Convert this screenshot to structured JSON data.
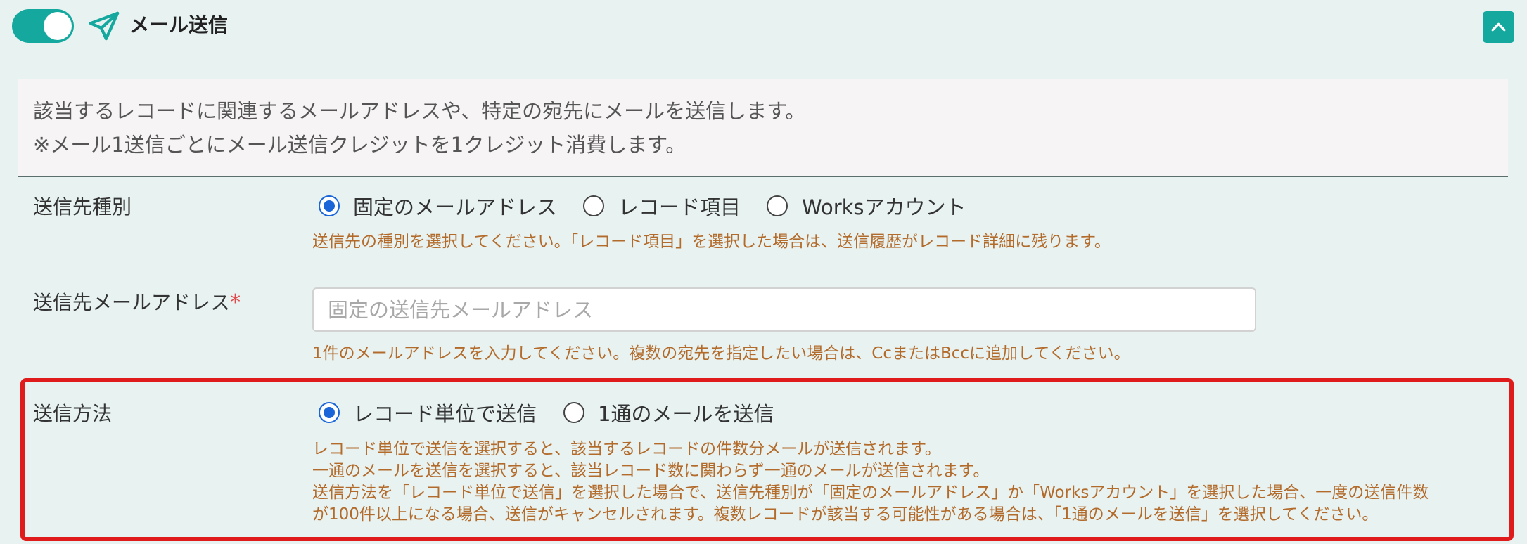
{
  "header": {
    "title": "メール送信",
    "toggle_on": true,
    "accent_color": "#14a89e"
  },
  "info": {
    "line1": "該当するレコードに関連するメールアドレスや、特定の宛先にメールを送信します。",
    "line2": "※メール1送信ごとにメール送信クレジットを1クレジット消費します。"
  },
  "destination_type": {
    "label": "送信先種別",
    "options": [
      {
        "label": "固定のメールアドレス",
        "selected": true
      },
      {
        "label": "レコード項目",
        "selected": false
      },
      {
        "label": "Worksアカウント",
        "selected": false
      }
    ],
    "help": "送信先の種別を選択してください。「レコード項目」を選択した場合は、送信履歴がレコード詳細に残ります。"
  },
  "destination_email": {
    "label": "送信先メールアドレス",
    "required_mark": "*",
    "placeholder": "固定の送信先メールアドレス",
    "value": "",
    "help": "1件のメールアドレスを入力してください。複数の宛先を指定したい場合は、CcまたはBccに追加してください。"
  },
  "send_method": {
    "label": "送信方法",
    "options": [
      {
        "label": "レコード単位で送信",
        "selected": true
      },
      {
        "label": "1通のメールを送信",
        "selected": false
      }
    ],
    "help_lines": [
      "レコード単位で送信を選択すると、該当するレコードの件数分メールが送信されます。",
      "一通のメールを送信を選択すると、該当レコード数に関わらず一通のメールが送信されます。",
      "送信方法を「レコード単位で送信」を選択した場合で、送信先種別が「固定のメールアドレス」か「Worksアカウント」を選択した場合、一度の送信件数",
      "が100件以上になる場合、送信がキャンセルされます。複数レコードが該当する可能性がある場合は、「1通のメールを送信」を選択してください。"
    ]
  },
  "colors": {
    "background": "#e7f2f1",
    "help_text": "#b36b2b",
    "radio_selected": "#1a66d8",
    "highlight_border": "#e01b1b",
    "required": "#e04a4a"
  },
  "icons": {
    "title_icon": "paper-plane-icon",
    "collapse_icon": "chevron-up-icon"
  }
}
